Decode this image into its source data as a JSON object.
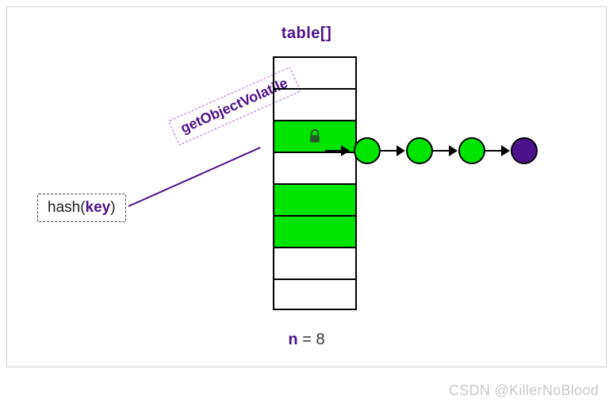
{
  "title": "table[]",
  "caption_var": "n",
  "caption_eq": " = 8",
  "hash_prefix": "hash(",
  "hash_key": "key",
  "hash_suffix": ")",
  "getObjectVolatile": "getObjectVolatile",
  "slots": [
    {
      "filled": false,
      "locked": false
    },
    {
      "filled": false,
      "locked": false
    },
    {
      "filled": true,
      "locked": true
    },
    {
      "filled": false,
      "locked": false
    },
    {
      "filled": true,
      "locked": false
    },
    {
      "filled": true,
      "locked": false
    },
    {
      "filled": false,
      "locked": false
    },
    {
      "filled": false,
      "locked": false
    }
  ],
  "chain": [
    "green",
    "green",
    "green",
    "purple"
  ],
  "watermark": "CSDN @KillerNoBlood",
  "icons": {
    "lock": "lock-icon"
  }
}
